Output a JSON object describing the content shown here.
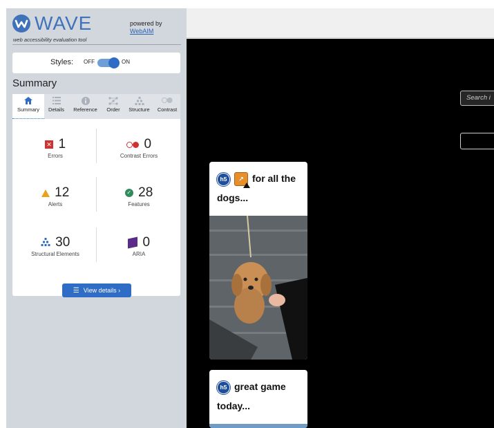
{
  "wave": {
    "logo_text": "WAVE",
    "tagline": "web accessibility evaluation tool",
    "powered_by": "powered by",
    "webaim_link": "WebAIM",
    "styles": {
      "label": "Styles:",
      "off": "OFF",
      "on": "ON",
      "enabled": true
    },
    "summary_heading": "Summary",
    "tabs": [
      {
        "label": "Summary",
        "icon": "home-icon",
        "active": true
      },
      {
        "label": "Details",
        "icon": "list-icon",
        "active": false
      },
      {
        "label": "Reference",
        "icon": "info-icon",
        "active": false
      },
      {
        "label": "Order",
        "icon": "order-icon",
        "active": false
      },
      {
        "label": "Structure",
        "icon": "structure-icon",
        "active": false
      },
      {
        "label": "Contrast",
        "icon": "contrast-icon",
        "active": false
      }
    ],
    "stats": {
      "errors": {
        "count": "1",
        "label": "Errors"
      },
      "contrast_errors": {
        "count": "0",
        "label": "Contrast Errors"
      },
      "alerts": {
        "count": "12",
        "label": "Alerts"
      },
      "features": {
        "count": "28",
        "label": "Features"
      },
      "structural": {
        "count": "30",
        "label": "Structural Elements"
      },
      "aria": {
        "count": "0",
        "label": "ARIA"
      }
    },
    "view_details": "View details ›"
  },
  "page": {
    "search_placeholder": "Search i",
    "posts": [
      {
        "badge": "h5",
        "title_line1": "for all the",
        "title_line2": "dogs..."
      },
      {
        "badge": "h5",
        "title_line1": "great game",
        "title_line2": "today..."
      }
    ]
  },
  "colors": {
    "wave_blue": "#2f6cc6",
    "error_red": "#d03131",
    "alert_orange": "#e8a21b",
    "feature_green": "#2f8a5c",
    "aria_purple": "#5b2b8a",
    "sidebar_bg": "#d2d7de"
  }
}
